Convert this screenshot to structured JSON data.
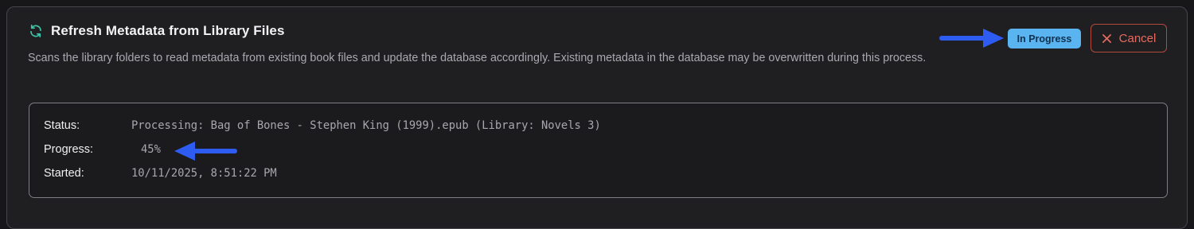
{
  "task": {
    "title": "Refresh Metadata from Library Files",
    "description": "Scans the library folders to read metadata from existing book files and update the database accordingly. Existing metadata in the database may be overwritten during this process.",
    "status_badge": "In Progress",
    "cancel_label": "Cancel",
    "icon": "refresh-icon"
  },
  "details": {
    "status_label": "Status:",
    "status_value": "Processing: Bag of Bones - Stephen King (1999).epub (Library: Novels 3)",
    "progress_label": "Progress:",
    "progress_value": "45%",
    "progress_fraction": 0.45,
    "started_label": "Started:",
    "started_value": "10/11/2025, 8:51:22 PM"
  },
  "colors": {
    "accent_teal": "#3ec6a8",
    "badge_blue": "#5ab4f0",
    "cancel_red": "#e86a5e",
    "annotation_arrow": "#2f5cf0"
  }
}
